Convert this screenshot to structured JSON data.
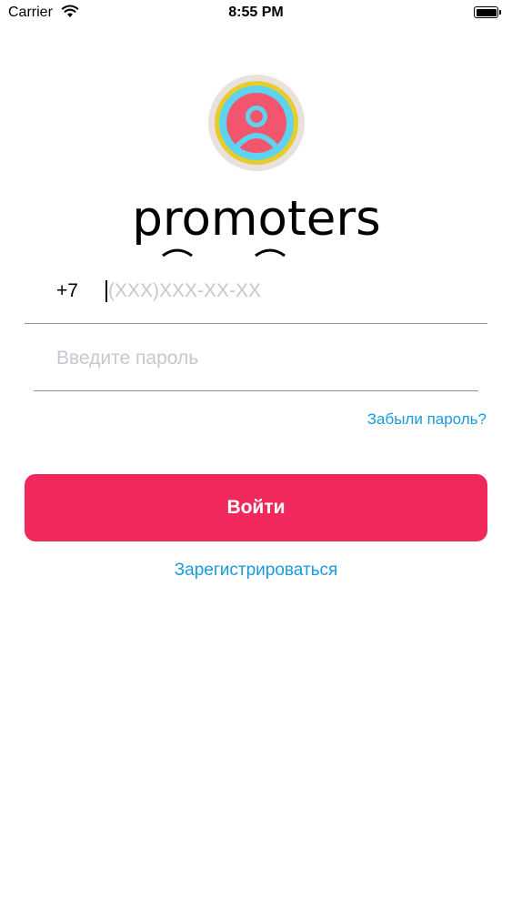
{
  "status_bar": {
    "carrier": "Carrier",
    "time": "8:55 PM",
    "wifi_icon": "wifi-icon",
    "battery_icon": "battery-icon"
  },
  "logo": {
    "emblem_icon": "user-circle-emblem",
    "wordmark": "promoters",
    "colors": {
      "outer": "#e8e1de",
      "yellow": "#e7cc2b",
      "cyan": "#5ed3ef",
      "pink": "#f2566f"
    }
  },
  "form": {
    "phone_prefix": "+7",
    "phone_placeholder": "(XXX)XXX-XX-XX",
    "password_placeholder": "Введите пароль"
  },
  "actions": {
    "forgot_password": "Забыли пароль?",
    "login": "Войти",
    "register": "Зарегистрироваться"
  },
  "colors": {
    "accent": "#f0285b",
    "link": "#1a9ae0"
  }
}
